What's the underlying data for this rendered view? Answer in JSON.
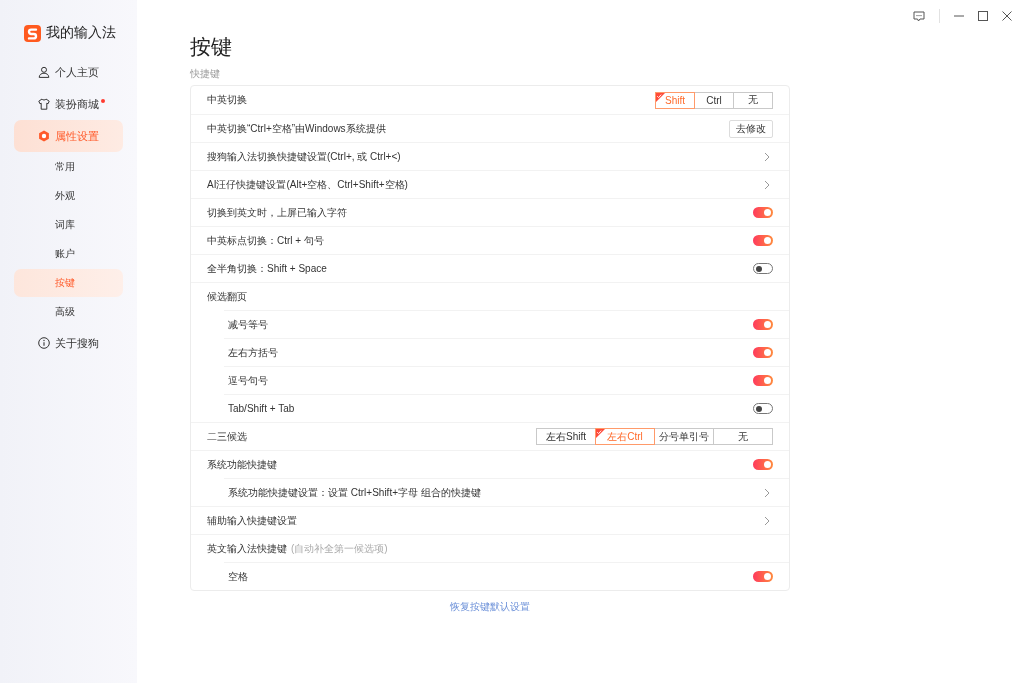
{
  "sidebar": {
    "app_name": "我的输入法",
    "items": [
      {
        "label": "个人主页",
        "selected": false,
        "badge_dot": false
      },
      {
        "label": "装扮商城",
        "selected": false,
        "badge_dot": true
      },
      {
        "label": "属性设置",
        "selected": true,
        "badge_dot": false,
        "children": [
          {
            "label": "常用",
            "selected": false
          },
          {
            "label": "外观",
            "selected": false
          },
          {
            "label": "词库",
            "selected": false
          },
          {
            "label": "账户",
            "selected": false
          },
          {
            "label": "按键",
            "selected": true
          },
          {
            "label": "高级",
            "selected": false
          }
        ]
      },
      {
        "label": "关于搜狗",
        "selected": false,
        "badge_dot": false
      }
    ]
  },
  "page": {
    "title": "按键",
    "section": "快捷键"
  },
  "settings": [
    {
      "label": "中英切换",
      "kind": "segmented",
      "options": [
        {
          "label": "Shift",
          "selected": true
        },
        {
          "label": "Ctrl",
          "selected": false
        },
        {
          "label": "无",
          "selected": false
        }
      ]
    },
    {
      "label": "中英切换“Ctrl+空格”由Windows系统提供",
      "kind": "button",
      "button": "去修改"
    },
    {
      "label": "搜狗输入法切换快捷键设置(Ctrl+, 或 Ctrl+<)",
      "kind": "link"
    },
    {
      "label": "AI汪仔快捷键设置(Alt+空格、Ctrl+Shift+空格)",
      "kind": "link"
    },
    {
      "label": "切换到英文时，上屏已输入字符",
      "kind": "toggle",
      "on": true
    },
    {
      "label": "中英标点切换：Ctrl + 句号",
      "kind": "toggle",
      "on": true
    },
    {
      "label": "全半角切换：Shift + Space",
      "kind": "toggle",
      "on": false
    },
    {
      "label": "候选翻页",
      "kind": "group",
      "children": [
        {
          "label": "减号等号",
          "kind": "toggle",
          "on": true
        },
        {
          "label": "左右方括号",
          "kind": "toggle",
          "on": true
        },
        {
          "label": "逗号句号",
          "kind": "toggle",
          "on": true
        },
        {
          "label": "Tab/Shift + Tab",
          "kind": "toggle",
          "on": false
        }
      ]
    },
    {
      "label": "二三候选",
      "kind": "segmented",
      "options": [
        {
          "label": "左右Shift",
          "selected": false
        },
        {
          "label": "左右Ctrl",
          "selected": true
        },
        {
          "label": "分号单引号",
          "selected": false
        },
        {
          "label": "无",
          "selected": false
        }
      ]
    },
    {
      "label": "系统功能快捷键",
      "kind": "toggle",
      "on": true,
      "children": [
        {
          "label": "系统功能快捷键设置：设置 Ctrl+Shift+字母 组合的快捷键",
          "kind": "link"
        }
      ]
    },
    {
      "label": "辅助输入快捷键设置",
      "kind": "link"
    },
    {
      "label": "英文输入法快捷键",
      "kind": "group",
      "note": "(自动补全第一候选项)",
      "children": [
        {
          "label": "空格",
          "kind": "toggle",
          "on": true
        }
      ]
    }
  ],
  "restore_link": "恢复按键默认设置"
}
